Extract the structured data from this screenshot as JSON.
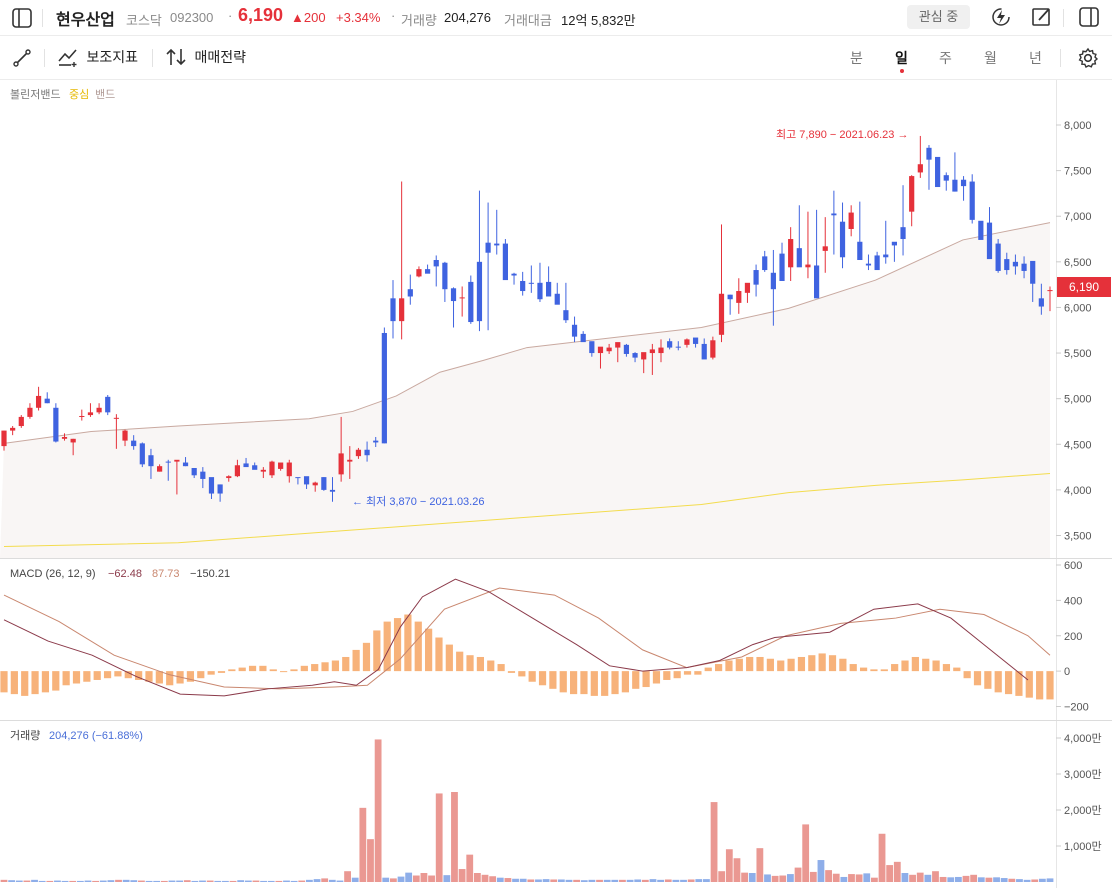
{
  "header": {
    "name": "현우산업",
    "market": "코스닥",
    "code": "092300",
    "price": "6,190",
    "change": "▲200",
    "change_pct": "+3.34%",
    "volume_label": "거래량",
    "volume": "204,276",
    "amount_label": "거래대금",
    "amount": "12억 5,832만",
    "watch_button": "관심 중"
  },
  "toolbar": {
    "indicator_label": "보조지표",
    "strategy_label": "매매전략",
    "periods": [
      "분",
      "일",
      "주",
      "월",
      "년"
    ],
    "active_period": "일"
  },
  "colors": {
    "up": "#e5313a",
    "down": "#3f63e0",
    "macd": "#8b3a4a",
    "signal": "#c9876f",
    "hist": "#f7b27a",
    "bb_mid": "#c9a9a0",
    "bb_long": "#f3dc4e"
  },
  "chart_data": [
    {
      "type": "candlestick",
      "legend": {
        "name": "볼린저밴드",
        "mid": "중심",
        "band": "밴드"
      },
      "y_ticks": [
        "8,000",
        "7,500",
        "7,000",
        "6,500",
        "6,000",
        "5,500",
        "5,000",
        "4,500",
        "4,000",
        "3,500"
      ],
      "ylim": [
        3300,
        8300
      ],
      "current_price_label": "6,190",
      "high_annotation": "최고 7,890 − 2021.06.23 →",
      "low_annotation": "← 최저 3,870 − 2021.03.26",
      "candles": [
        [
          4480,
          4650,
          4430,
          4650
        ],
        [
          4650,
          4700,
          4600,
          4680
        ],
        [
          4700,
          4820,
          4680,
          4800
        ],
        [
          4800,
          4950,
          4780,
          4900
        ],
        [
          4900,
          5130,
          4870,
          5030
        ],
        [
          5000,
          5070,
          4950,
          4950
        ],
        [
          4900,
          4950,
          4520,
          4530
        ],
        [
          4560,
          4620,
          4540,
          4580
        ],
        [
          4520,
          4560,
          4380,
          4560
        ],
        [
          4800,
          4880,
          4760,
          4810
        ],
        [
          4820,
          4950,
          4800,
          4850
        ],
        [
          4850,
          4950,
          4830,
          4900
        ],
        [
          5020,
          5040,
          4820,
          4850
        ],
        [
          4790,
          4830,
          4450,
          4790
        ],
        [
          4540,
          4660,
          4480,
          4650
        ],
        [
          4540,
          4600,
          4440,
          4480
        ],
        [
          4510,
          4520,
          4250,
          4280
        ],
        [
          4380,
          4450,
          4120,
          4260
        ],
        [
          4200,
          4280,
          4200,
          4260
        ],
        [
          4310,
          4330,
          4100,
          4300
        ],
        [
          4310,
          4320,
          3950,
          4330
        ],
        [
          4300,
          4360,
          4260,
          4260
        ],
        [
          4240,
          4230,
          4130,
          4160
        ],
        [
          4200,
          4250,
          4020,
          4120
        ],
        [
          4140,
          4130,
          3900,
          3960
        ],
        [
          4060,
          4060,
          3870,
          3960
        ],
        [
          4130,
          4160,
          4090,
          4150
        ],
        [
          4150,
          4330,
          4140,
          4270
        ],
        [
          4290,
          4350,
          4260,
          4250
        ],
        [
          4270,
          4300,
          4250,
          4220
        ],
        [
          4200,
          4250,
          4130,
          4220
        ],
        [
          4160,
          4320,
          4130,
          4310
        ],
        [
          4230,
          4280,
          4210,
          4300
        ],
        [
          4150,
          4330,
          4080,
          4300
        ],
        [
          4140,
          4130,
          4060,
          4130
        ],
        [
          4150,
          4130,
          4010,
          4060
        ],
        [
          4050,
          4090,
          3980,
          4080
        ],
        [
          4140,
          4140,
          3990,
          4000
        ],
        [
          4000,
          4140,
          3870,
          3980
        ],
        [
          4170,
          4800,
          4090,
          4400
        ],
        [
          4310,
          4480,
          4120,
          4330
        ],
        [
          4370,
          4460,
          4340,
          4440
        ],
        [
          4440,
          4530,
          4310,
          4380
        ],
        [
          4540,
          4580,
          4470,
          4520
        ],
        [
          5720,
          5780,
          4510,
          4510
        ],
        [
          6100,
          6300,
          5660,
          5850
        ],
        [
          5850,
          7380,
          5650,
          6100
        ],
        [
          6200,
          6360,
          6030,
          6120
        ],
        [
          6340,
          6450,
          6330,
          6420
        ],
        [
          6420,
          6470,
          6390,
          6370
        ],
        [
          6520,
          6570,
          6230,
          6450
        ],
        [
          6490,
          6500,
          6060,
          6200
        ],
        [
          6210,
          6220,
          5780,
          6070
        ],
        [
          6100,
          6230,
          5900,
          6110
        ],
        [
          6280,
          6350,
          5820,
          5840
        ],
        [
          6500,
          7280,
          5740,
          5850
        ],
        [
          6710,
          7150,
          5750,
          6600
        ],
        [
          6700,
          7070,
          6580,
          6680
        ],
        [
          6700,
          6750,
          6320,
          6300
        ],
        [
          6370,
          6380,
          6250,
          6350
        ],
        [
          6290,
          6390,
          6130,
          6180
        ],
        [
          6270,
          6460,
          6160,
          6260
        ],
        [
          6270,
          6490,
          6060,
          6090
        ],
        [
          6280,
          6450,
          6190,
          6120
        ],
        [
          6150,
          6270,
          6040,
          6030
        ],
        [
          5970,
          6270,
          5830,
          5860
        ],
        [
          5810,
          5900,
          5620,
          5680
        ],
        [
          5710,
          5740,
          5650,
          5620
        ],
        [
          5630,
          5620,
          5460,
          5500
        ],
        [
          5500,
          5500,
          5330,
          5570
        ],
        [
          5520,
          5600,
          5490,
          5560
        ],
        [
          5560,
          5600,
          5400,
          5620
        ],
        [
          5590,
          5600,
          5460,
          5490
        ],
        [
          5500,
          5510,
          5400,
          5450
        ],
        [
          5430,
          5480,
          5280,
          5510
        ],
        [
          5500,
          5600,
          5260,
          5540
        ],
        [
          5500,
          5650,
          5400,
          5560
        ],
        [
          5630,
          5660,
          5540,
          5560
        ],
        [
          5570,
          5630,
          5530,
          5560
        ],
        [
          5590,
          5660,
          5560,
          5650
        ],
        [
          5670,
          5650,
          5560,
          5600
        ],
        [
          5600,
          5660,
          5440,
          5430
        ],
        [
          5450,
          5680,
          5430,
          5640
        ],
        [
          5700,
          6910,
          5620,
          6150
        ],
        [
          6140,
          6140,
          5920,
          6090
        ],
        [
          6050,
          6320,
          5930,
          6180
        ],
        [
          6160,
          6230,
          6050,
          6270
        ],
        [
          6410,
          6470,
          6120,
          6250
        ],
        [
          6560,
          6620,
          6390,
          6410
        ],
        [
          6380,
          6630,
          5800,
          6200
        ],
        [
          6590,
          6710,
          6300,
          6290
        ],
        [
          6440,
          6880,
          6290,
          6750
        ],
        [
          6650,
          7120,
          6560,
          6440
        ],
        [
          6440,
          7050,
          6320,
          6470
        ],
        [
          6460,
          7070,
          6140,
          6100
        ],
        [
          6620,
          6990,
          6380,
          6670
        ],
        [
          7030,
          7280,
          6580,
          7010
        ],
        [
          6940,
          7150,
          6430,
          6550
        ],
        [
          6860,
          7120,
          6780,
          7040
        ],
        [
          6720,
          7160,
          6620,
          6520
        ],
        [
          6480,
          6580,
          6410,
          6460
        ],
        [
          6570,
          6610,
          6420,
          6410
        ],
        [
          6580,
          6950,
          6480,
          6550
        ],
        [
          6720,
          6710,
          6500,
          6680
        ],
        [
          6880,
          7340,
          6570,
          6750
        ],
        [
          7050,
          7450,
          6890,
          7440
        ],
        [
          7480,
          7880,
          7420,
          7570
        ],
        [
          7750,
          7780,
          7290,
          7620
        ],
        [
          7650,
          7630,
          7440,
          7320
        ],
        [
          7450,
          7480,
          7280,
          7390
        ],
        [
          7400,
          7700,
          7270,
          7270
        ],
        [
          7400,
          7440,
          7170,
          7330
        ],
        [
          7380,
          7460,
          6920,
          6960
        ],
        [
          6950,
          6800,
          6780,
          6740
        ],
        [
          6930,
          7100,
          6550,
          6530
        ],
        [
          6700,
          6750,
          6380,
          6400
        ],
        [
          6530,
          6600,
          6360,
          6410
        ],
        [
          6500,
          6580,
          6360,
          6450
        ],
        [
          6480,
          6560,
          6320,
          6400
        ],
        [
          6510,
          6490,
          6060,
          6260
        ],
        [
          6100,
          6260,
          5920,
          6010
        ],
        [
          6180,
          6230,
          5960,
          6190
        ]
      ],
      "bb_mid": [
        [
          0,
          4510
        ],
        [
          10,
          4640
        ],
        [
          20,
          4700
        ],
        [
          35,
          4780
        ],
        [
          40,
          4860
        ],
        [
          45,
          5030
        ],
        [
          50,
          5290
        ],
        [
          55,
          5420
        ],
        [
          60,
          5560
        ],
        [
          70,
          5670
        ],
        [
          80,
          5780
        ],
        [
          90,
          5990
        ],
        [
          100,
          6300
        ],
        [
          110,
          6740
        ],
        [
          120,
          6930
        ]
      ],
      "bb_long": [
        [
          0,
          3380
        ],
        [
          20,
          3420
        ],
        [
          40,
          3560
        ],
        [
          60,
          3700
        ],
        [
          80,
          3840
        ],
        [
          90,
          3970
        ],
        [
          100,
          4050
        ],
        [
          110,
          4110
        ],
        [
          120,
          4180
        ]
      ]
    },
    {
      "type": "line",
      "title": "MACD (26, 12, 9)",
      "values_text": [
        "−62.48",
        "87.73",
        "−150.21"
      ],
      "y_ticks": [
        "600",
        "400",
        "200",
        "0",
        "−200"
      ],
      "ylim": [
        -290,
        600
      ],
      "macd": [
        [
          0,
          290
        ],
        [
          8,
          170
        ],
        [
          16,
          90
        ],
        [
          24,
          -30
        ],
        [
          32,
          -130
        ],
        [
          40,
          -140
        ],
        [
          48,
          -100
        ],
        [
          56,
          -80
        ],
        [
          60,
          -60
        ],
        [
          64,
          -80
        ],
        [
          68,
          10
        ],
        [
          72,
          250
        ],
        [
          76,
          420
        ],
        [
          82,
          520
        ],
        [
          88,
          450
        ],
        [
          96,
          300
        ],
        [
          104,
          150
        ],
        [
          110,
          30
        ],
        [
          116,
          0
        ],
        [
          124,
          20
        ],
        [
          130,
          60
        ],
        [
          136,
          150
        ],
        [
          140,
          190
        ],
        [
          150,
          220
        ],
        [
          158,
          350
        ],
        [
          166,
          380
        ],
        [
          172,
          300
        ],
        [
          178,
          150
        ],
        [
          184,
          0
        ],
        [
          186,
          -50
        ]
      ],
      "signal": [
        [
          0,
          430
        ],
        [
          10,
          280
        ],
        [
          20,
          90
        ],
        [
          30,
          -20
        ],
        [
          40,
          -90
        ],
        [
          50,
          -100
        ],
        [
          60,
          -90
        ],
        [
          66,
          -80
        ],
        [
          72,
          70
        ],
        [
          80,
          350
        ],
        [
          90,
          470
        ],
        [
          100,
          430
        ],
        [
          108,
          300
        ],
        [
          116,
          120
        ],
        [
          124,
          20
        ],
        [
          134,
          80
        ],
        [
          142,
          200
        ],
        [
          152,
          270
        ],
        [
          162,
          300
        ],
        [
          170,
          350
        ],
        [
          178,
          320
        ],
        [
          186,
          200
        ],
        [
          190,
          90
        ]
      ],
      "hist": [
        -120,
        -130,
        -140,
        -130,
        -120,
        -110,
        -80,
        -70,
        -60,
        -50,
        -40,
        -30,
        -40,
        -50,
        -60,
        -70,
        -80,
        -70,
        -60,
        -40,
        -20,
        -10,
        10,
        20,
        30,
        30,
        10,
        0,
        10,
        30,
        40,
        50,
        60,
        80,
        120,
        160,
        230,
        280,
        300,
        320,
        280,
        240,
        190,
        150,
        110,
        90,
        80,
        60,
        40,
        -10,
        -30,
        -60,
        -80,
        -100,
        -120,
        -130,
        -130,
        -140,
        -140,
        -130,
        -120,
        -100,
        -90,
        -70,
        -50,
        -40,
        -20,
        -20,
        20,
        40,
        60,
        70,
        80,
        80,
        70,
        60,
        70,
        80,
        90,
        100,
        90,
        70,
        40,
        20,
        10,
        10,
        40,
        60,
        80,
        70,
        60,
        40,
        20,
        -40,
        -80,
        -100,
        -120,
        -130,
        -140,
        -150,
        -160,
        -160
      ]
    },
    {
      "type": "bar",
      "title": "거래량",
      "value_text": "204,276 (−61.88%)",
      "y_ticks": [
        "4,000만",
        "3,000만",
        "2,000만",
        "1,000만"
      ],
      "ylim": [
        0,
        4200
      ],
      "values": [
        60,
        50,
        40,
        40,
        60,
        30,
        30,
        40,
        30,
        30,
        30,
        40,
        30,
        40,
        50,
        60,
        60,
        50,
        40,
        30,
        30,
        30,
        40,
        40,
        50,
        30,
        40,
        40,
        30,
        30,
        30,
        50,
        40,
        40,
        30,
        30,
        30,
        40,
        30,
        40,
        60,
        80,
        100,
        60,
        40,
        300,
        120,
        2060,
        1190,
        3960,
        120,
        100,
        150,
        260,
        180,
        250,
        180,
        2460,
        190,
        2500,
        360,
        760,
        250,
        200,
        160,
        120,
        110,
        90,
        90,
        70,
        70,
        80,
        70,
        70,
        60,
        60,
        50,
        60,
        60,
        60,
        60,
        60,
        60,
        70,
        60,
        80,
        60,
        70,
        60,
        60,
        70,
        80,
        80,
        2220,
        300,
        910,
        660,
        260,
        250,
        940,
        210,
        170,
        180,
        220,
        400,
        1600,
        280,
        610,
        330,
        230,
        140,
        220,
        210,
        240,
        120,
        1340,
        470,
        560,
        250,
        200,
        260,
        200,
        300,
        140,
        130,
        140,
        170,
        200,
        130,
        120,
        130,
        110,
        90,
        80,
        60,
        70,
        90,
        100
      ]
    }
  ]
}
